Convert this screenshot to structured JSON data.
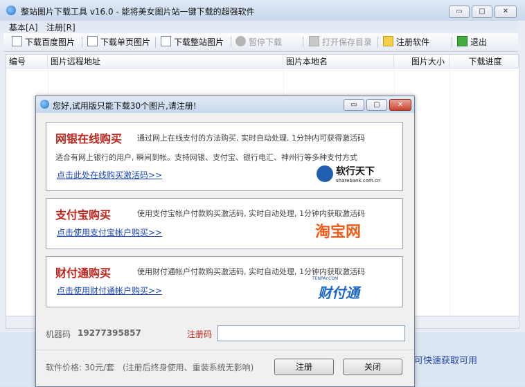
{
  "window": {
    "title": "整站图片下载工具 v16.0 - 能将美女图片站一键下载的超强软件",
    "controls": {
      "minimize": "▭",
      "maximize": "▢",
      "close": "✕"
    }
  },
  "menu": [
    "基本[A]",
    "注册[R]"
  ],
  "toolbar": {
    "buttons": [
      {
        "label": "下载百度图片",
        "enabled": true,
        "icon": "globe-download-icon"
      },
      {
        "label": "下载单页图片",
        "enabled": true,
        "icon": "page-icon"
      },
      {
        "label": "下载整站图片",
        "enabled": true,
        "icon": "site-icon"
      },
      {
        "label": "暂停下载",
        "enabled": false,
        "icon": "pause-icon"
      },
      {
        "label": "打开保存目录",
        "enabled": false,
        "icon": "folder-icon"
      },
      {
        "label": "注册软件",
        "enabled": true,
        "icon": "register-icon"
      },
      {
        "label": "退出",
        "enabled": true,
        "icon": "exit-icon"
      }
    ]
  },
  "table": {
    "columns": [
      "编号",
      "图片远程地址",
      "图片本地名",
      "图片大小",
      "下载进度"
    ],
    "rows": []
  },
  "status": {
    "right_text": "可快速获取可用"
  },
  "dialog": {
    "title": "您好,试用版只能下载30个图片,请注册!",
    "controls": {
      "minimize": "▭",
      "maximize": "▢",
      "close": "✕"
    },
    "panels": [
      {
        "title": "网银在线购买",
        "desc": "通过网上在线支付的方法购买, 实时自动处理, 1分钟内可获得激活码",
        "desc2": "适合有网上银行的用户, 瞬间到帐。支持网银、支付宝、银行电汇、神州行等多种支付方式",
        "link": "点击此处在线购买激活码>>",
        "logo_text": "软行天下",
        "logo_sub": "sharebank.com.cn"
      },
      {
        "title": "支付宝购买",
        "desc": "使用支付宝帐户付款购买激活码, 实时自动处理, 1分钟内获取激活码",
        "link": "点击使用支付宝帐户购买>>",
        "logo_text": "淘宝网"
      },
      {
        "title": "财付通购买",
        "desc": "使用财付通帐户付款购买激活码, 实时自动处理, 1分钟内获取激活码",
        "link": "点击使用财付通帐户购买>>",
        "logo_text": "财付通",
        "logo_sub": "TENPAY.COM"
      }
    ],
    "machine_label": "机器码",
    "machine_code": "19277395857",
    "reg_label": "注册码",
    "reg_value": "",
    "price": "软件价格: 30元/套",
    "price_note": "(注册后终身使用、重装系统无影响)",
    "register_btn": "注册",
    "close_btn": "关闭"
  }
}
